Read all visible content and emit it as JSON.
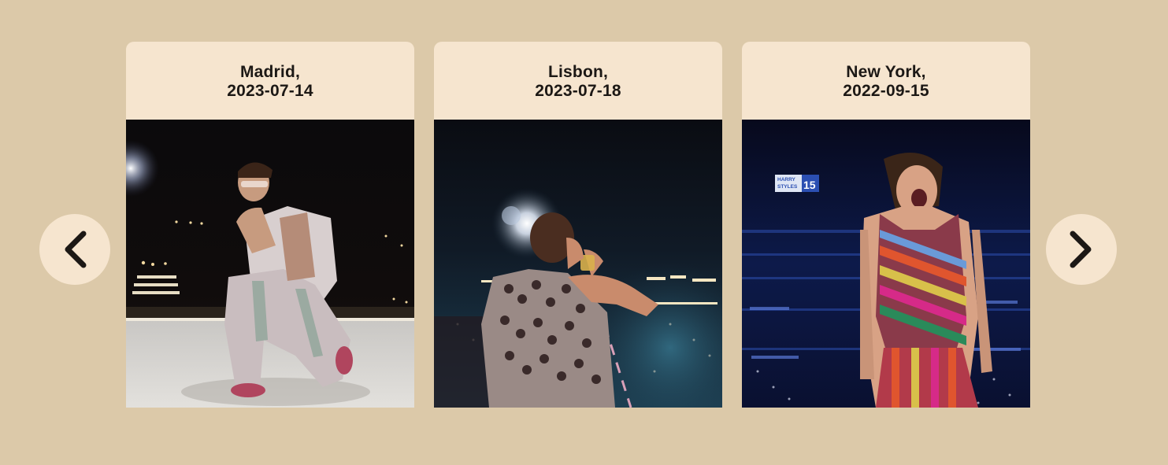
{
  "carousel": {
    "prev_icon": "chevron-left-icon",
    "next_icon": "chevron-right-icon",
    "cards": [
      {
        "city": "Madrid,",
        "date": "2023-07-14"
      },
      {
        "city": "Lisbon,",
        "date": "2023-07-18"
      },
      {
        "city": "New York,",
        "date": "2022-09-15"
      }
    ],
    "photo_banner_text": "HARRY STYLES 15"
  },
  "colors": {
    "background": "#dcc9a9",
    "card_header": "#f6e5cf",
    "text": "#1c1815"
  }
}
